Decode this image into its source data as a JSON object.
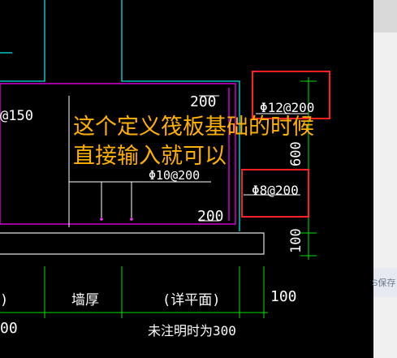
{
  "drawing": {
    "dims": {
      "top_200": "200",
      "bottom_200": "200",
      "vertical_600": "600",
      "vertical_100": "100",
      "bottom_100": "100",
      "left_partial_00": "00",
      "left_partial_0": ")"
    },
    "rebar": {
      "top_left": "@150",
      "top_right": "Φ12@200",
      "middle": "Φ10@200",
      "side": "Φ8@200"
    },
    "labels": {
      "wall_thickness": "墙厚",
      "see_plan": "(详平面)",
      "unnoted": "未注明时为300"
    },
    "annotation": {
      "line1": "这个定义筏板基础的时候",
      "line2": "直接输入就可以"
    }
  },
  "panel": {
    "save_label": "S保存"
  },
  "colors": {
    "background": "#000000",
    "cyan": "#00ffff",
    "magenta": "#ff00ff",
    "green": "#00ff00",
    "white": "#ffffff",
    "highlight_box": "#ff0000",
    "annotation_text": "#ffb000"
  }
}
